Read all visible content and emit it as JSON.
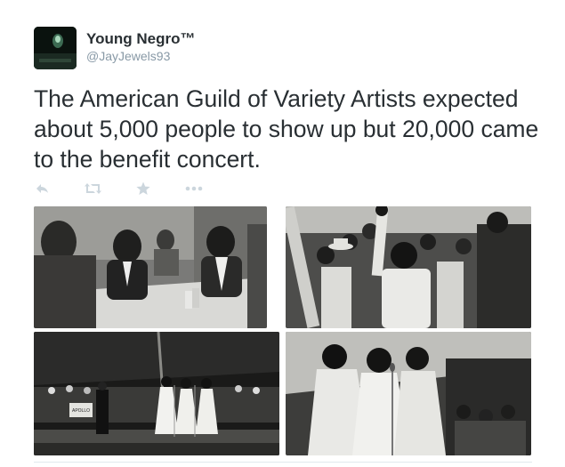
{
  "tweet": {
    "author": {
      "display_name": "Young Negro™",
      "handle": "@JayJewels93",
      "avatar_icon": "avatar-photo"
    },
    "text": "The American Guild of Variety Artists expected about 5,000 people to show up but 20,000 came to the benefit concert.",
    "actions": [
      {
        "name": "reply",
        "icon": "reply-icon"
      },
      {
        "name": "retweet",
        "icon": "retweet-icon"
      },
      {
        "name": "favorite",
        "icon": "star-icon"
      },
      {
        "name": "more",
        "icon": "ellipsis-icon"
      }
    ],
    "photos": [
      {
        "description_icon": "photo-meeting-table"
      },
      {
        "description_icon": "photo-crowd-raised-hand"
      },
      {
        "description_icon": "photo-stage-performers"
      },
      {
        "description_icon": "photo-singers-microphone"
      }
    ],
    "photo_stage_sign": "APOLLO"
  },
  "colors": {
    "text": "#292f33",
    "handle": "#8899a6",
    "action_icon": "#ccd6dd",
    "divider": "#e1e8ed"
  }
}
